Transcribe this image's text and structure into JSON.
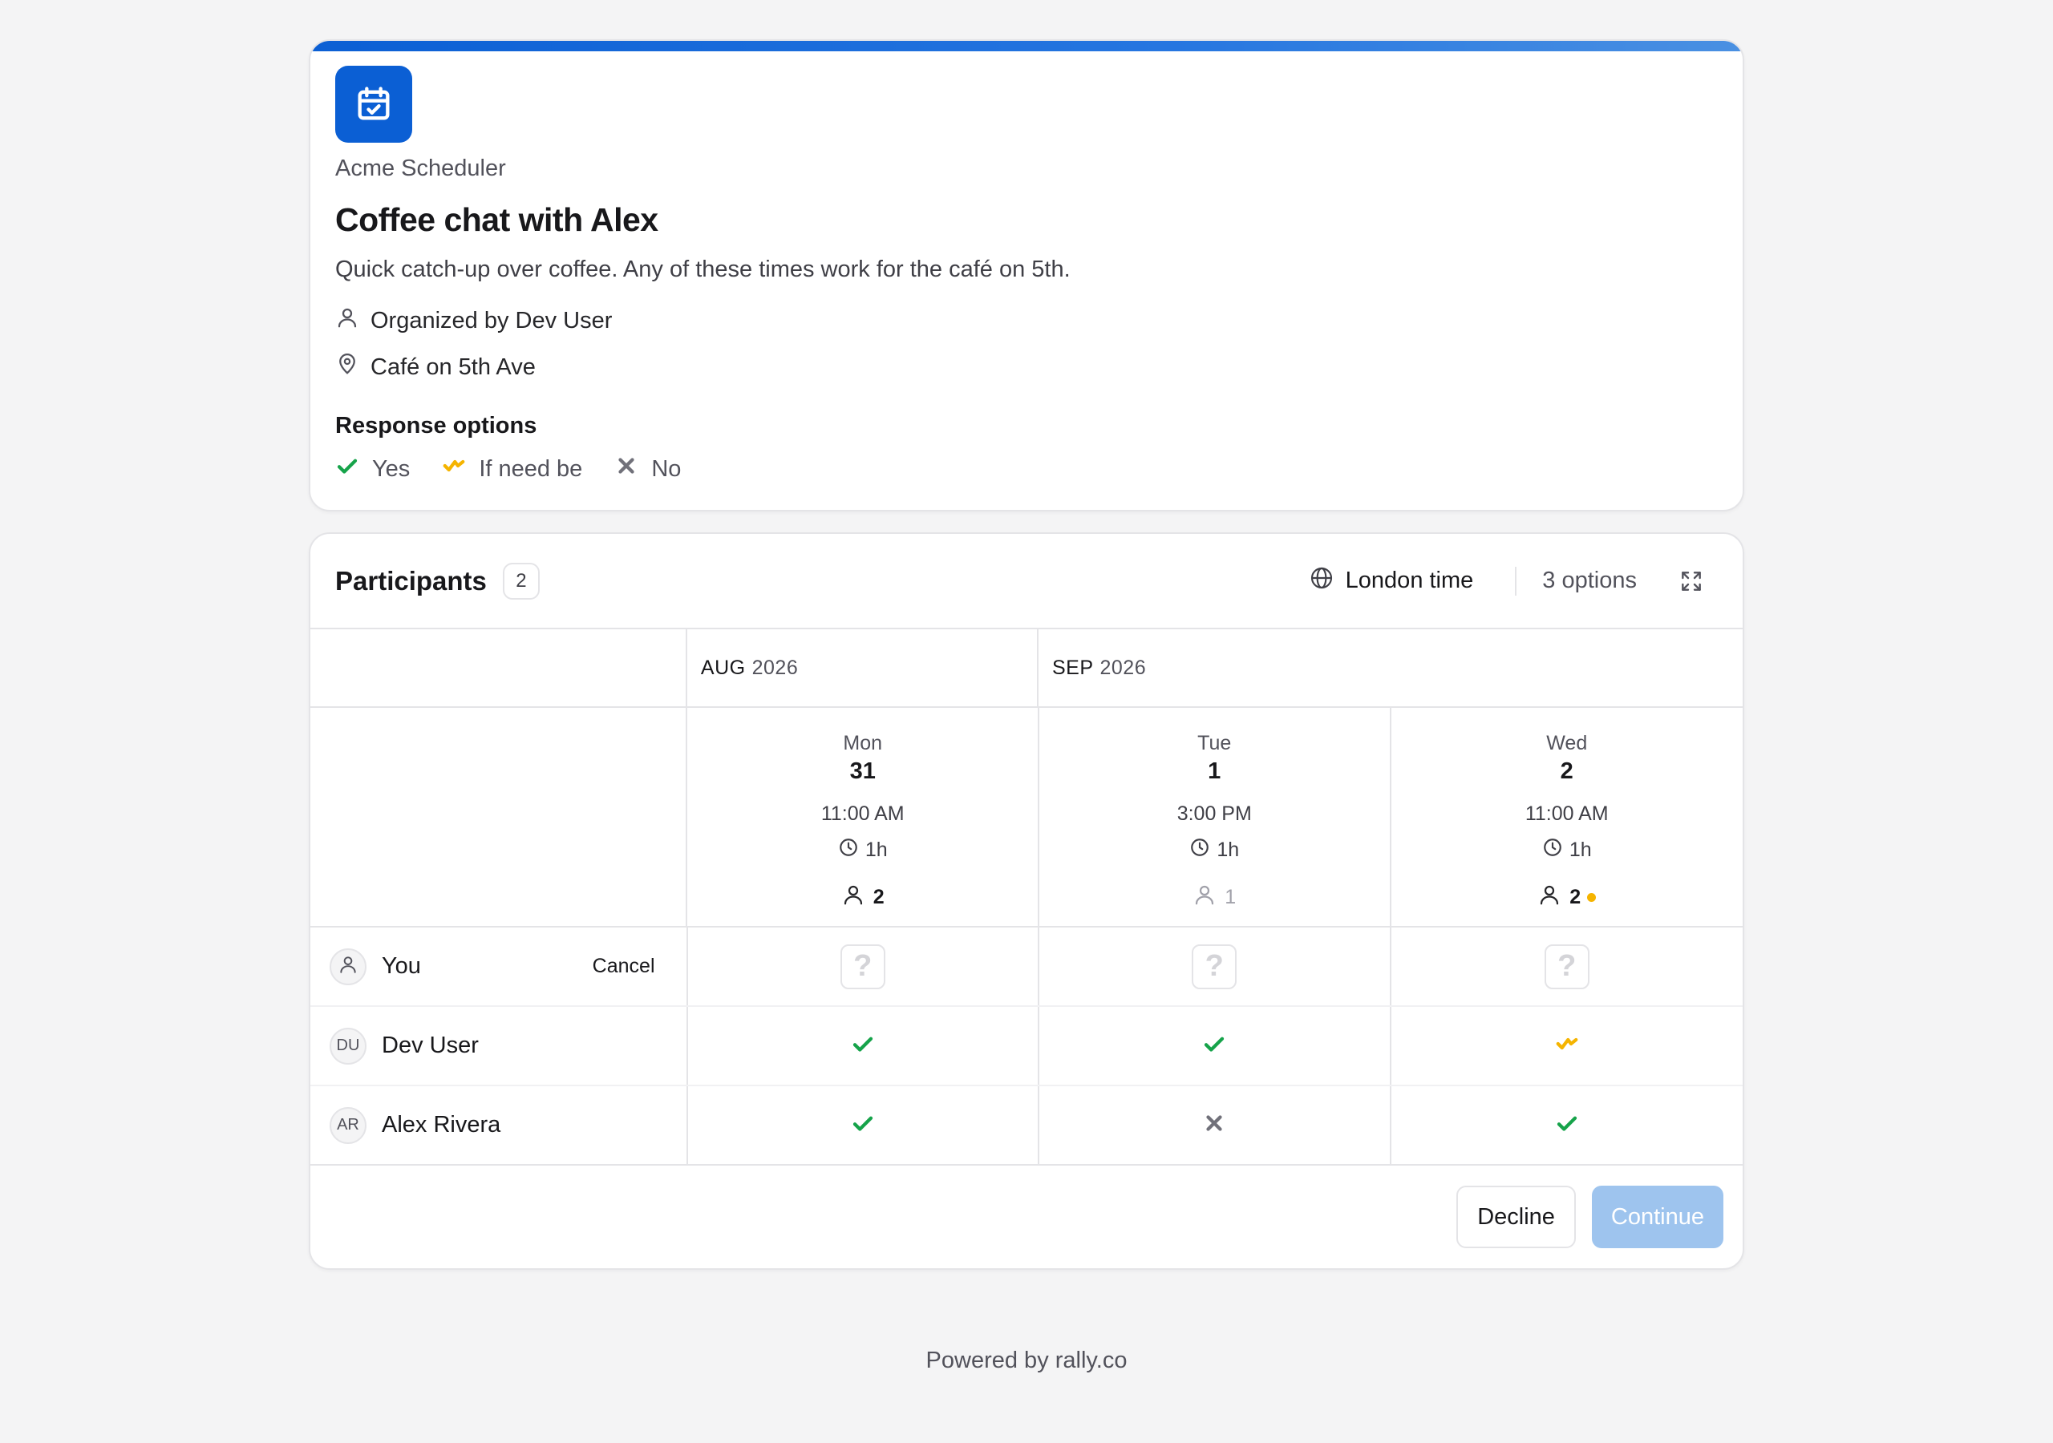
{
  "app": {
    "name": "Acme Scheduler",
    "icon": "calendar-check-icon",
    "brand_color": "#0b5fd4"
  },
  "event": {
    "title": "Coffee chat with Alex",
    "description": "Quick catch-up over coffee. Any of these times work for the café on 5th.",
    "organizer": "Organized by Dev User",
    "location": "Café on 5th Ave"
  },
  "response_options": {
    "title": "Response options",
    "yes": "Yes",
    "if_need_be": "If need be",
    "no": "No",
    "colors": {
      "yes": "#16a34a",
      "if_need_be": "#f5b400",
      "no": "#71717a"
    }
  },
  "participants": {
    "title": "Participants",
    "count": "2",
    "timezone": "London time",
    "options_count": "3 options"
  },
  "months": [
    {
      "month": "AUG",
      "year": "2026"
    },
    {
      "month": "SEP",
      "year": "2026"
    }
  ],
  "options": [
    {
      "dow": "Mon",
      "day": "31",
      "time": "11:00 AM",
      "duration": "1h",
      "attendees": "2",
      "highlight": false
    },
    {
      "dow": "Tue",
      "day": "1",
      "time": "3:00 PM",
      "duration": "1h",
      "attendees": "1",
      "highlight": false
    },
    {
      "dow": "Wed",
      "day": "2",
      "time": "11:00 AM",
      "duration": "1h",
      "attendees": "2",
      "highlight": true
    }
  ],
  "rows": [
    {
      "initials": "",
      "name": "You",
      "action": "Cancel",
      "votes": [
        "?",
        "?",
        "?"
      ]
    },
    {
      "initials": "DU",
      "name": "Dev User",
      "votes": [
        "yes",
        "yes",
        "if_need_be"
      ]
    },
    {
      "initials": "AR",
      "name": "Alex Rivera",
      "votes": [
        "yes",
        "no",
        "yes"
      ]
    }
  ],
  "buttons": {
    "decline": "Decline",
    "continue": "Continue"
  },
  "footer": "Powered by rally.co"
}
